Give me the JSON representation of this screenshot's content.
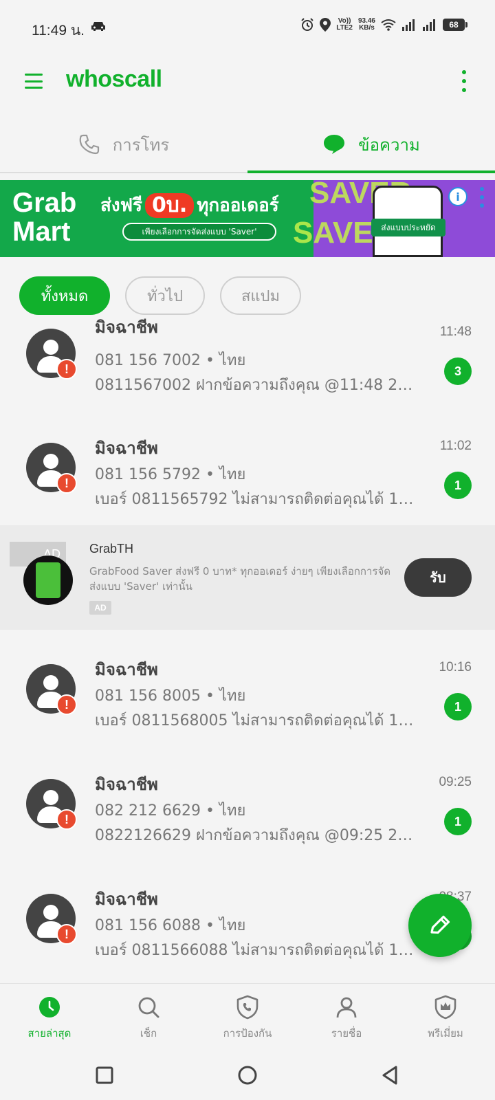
{
  "status_bar": {
    "time": "11:49 น.",
    "volte_top": "Vo))",
    "volte_bottom": "LTE2",
    "speed_value": "93.46",
    "speed_unit": "KB/s",
    "battery": "68",
    "icons": [
      "car-icon",
      "alarm-icon",
      "location-icon",
      "wifi-icon",
      "signal-icon",
      "signal-icon"
    ]
  },
  "app_bar": {
    "brand": "whoscall",
    "icons": [
      "menu-icon",
      "more-vert-icon"
    ]
  },
  "tabs": [
    {
      "label": "การโทร",
      "icon": "phone-icon",
      "active": false
    },
    {
      "label": "ข้อความ",
      "icon": "message-bubble-icon",
      "active": true
    }
  ],
  "banner_ad": {
    "logo_line1": "Grab",
    "logo_line2": "Mart",
    "headline_prefix": "ส่งฟรี",
    "headline_badge": "0บ.",
    "headline_suffix": "ทุกออเดอร์",
    "subline": "เพียงเลือกการจัดส่งแบบ 'Saver'",
    "bg_word": "SAVER",
    "phone_button": "ส่งแบบประหยัด",
    "info_icon": "info-icon"
  },
  "filters": [
    {
      "label": "ทั้งหมด",
      "active": true
    },
    {
      "label": "ทั่วไป",
      "active": false
    },
    {
      "label": "สแปม",
      "active": false
    }
  ],
  "messages": [
    {
      "title": "มิจฉาชีพ",
      "number": "081 156 7002 • ไทย",
      "preview": "0811567002 ฝากข้อความถึงคุณ @11:48 24/0...",
      "time": "11:48",
      "count": "3"
    },
    {
      "title": "มิจฉาชีพ",
      "number": "081 156 5792 • ไทย",
      "preview": "เบอร์ 0811565792 ไม่สามารถติดต่อคุณได้ 1 ค...",
      "time": "11:02",
      "count": "1"
    },
    {
      "title": "มิจฉาชีพ",
      "number": "081 156 8005 • ไทย",
      "preview": "เบอร์ 0811568005 ไม่สามารถติดต่อคุณได้ 1 ค...",
      "time": "10:16",
      "count": "1"
    },
    {
      "title": "มิจฉาชีพ",
      "number": "082 212 6629 • ไทย",
      "preview": "0822126629 ฝากข้อความถึงคุณ @09:25 24/0...",
      "time": "09:25",
      "count": "1"
    },
    {
      "title": "มิจฉาชีพ",
      "number": "081 156 6088 • ไทย",
      "preview": "เบอร์ 0811566088 ไม่สามารถติดต่อคุณได้ 1 ค...",
      "time": "08:37",
      "count": "1"
    }
  ],
  "native_ad": {
    "label": "AD",
    "title": "GrabTH",
    "description": "GrabFood Saver ส่งฟรี 0 บาท* ทุกออเดอร์ ง่ายๆ เพียงเลือกการจัดส่งแบบ 'Saver' เท่านั้น",
    "tag": "AD",
    "button": "รับ"
  },
  "fab": {
    "icon": "pencil-icon"
  },
  "bottom_nav": [
    {
      "label": "สายล่าสุด",
      "icon": "clock-icon",
      "active": true
    },
    {
      "label": "เช็ก",
      "icon": "search-icon",
      "active": false
    },
    {
      "label": "การป้องกัน",
      "icon": "shield-phone-icon",
      "active": false
    },
    {
      "label": "รายชื่อ",
      "icon": "person-icon",
      "active": false
    },
    {
      "label": "พรีเมี่ยม",
      "icon": "crown-shield-icon",
      "active": false
    }
  ],
  "colors": {
    "brand_green": "#11b12c",
    "warning_red": "#e84a2f",
    "background": "#f4f4f4"
  }
}
